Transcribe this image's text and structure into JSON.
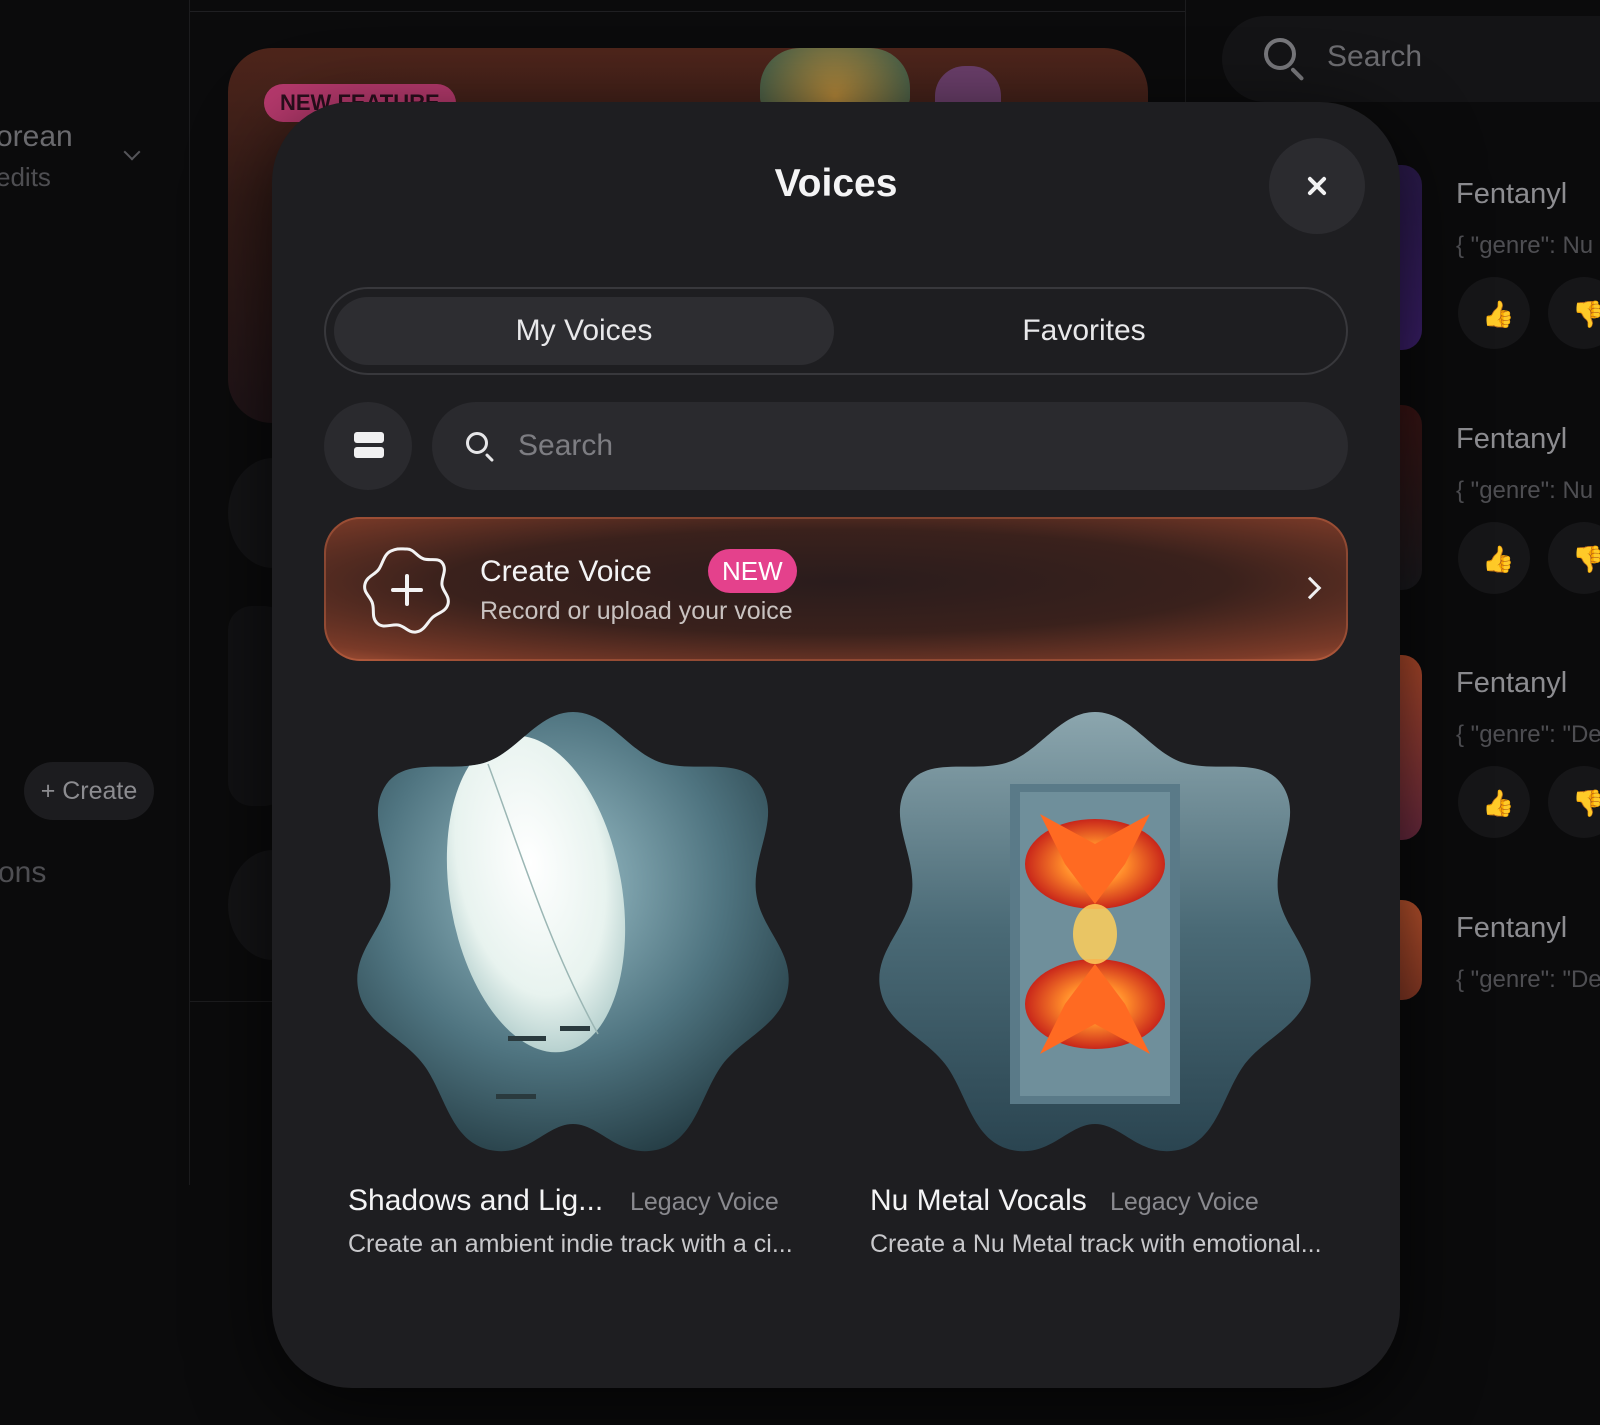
{
  "background": {
    "sidebar": {
      "account_name": "orean",
      "account_sub": "edits",
      "create_label": "+ Create",
      "section_label": "ons"
    },
    "feature_badge": "NEW FEATURE",
    "search_placeholder": "Search",
    "feed": [
      {
        "title": "Fentanyl",
        "subtitle": "{ \"genre\": Nu"
      },
      {
        "title": "Fentanyl",
        "subtitle": "{ \"genre\": Nu"
      },
      {
        "title": "Fentanyl",
        "subtitle": "{ \"genre\": \"De"
      },
      {
        "title": "Fentanyl",
        "subtitle": "{ \"genre\": \"De"
      }
    ]
  },
  "modal": {
    "title": "Voices",
    "tabs": [
      {
        "label": "My Voices",
        "active": true
      },
      {
        "label": "Favorites",
        "active": false
      }
    ],
    "search_placeholder": "Search",
    "create_card": {
      "title": "Create Voice",
      "badge": "NEW",
      "subtitle": "Record or upload your voice"
    },
    "voices": [
      {
        "name": "Shadows and Lig...",
        "tag": "Legacy Voice",
        "description": "Create an ambient indie track with a ci...",
        "art": "moon-portal"
      },
      {
        "name": "Nu Metal Vocals",
        "tag": "Legacy Voice",
        "description": "Create a Nu Metal track with emotional...",
        "art": "phoenix"
      }
    ]
  },
  "colors": {
    "modal_bg": "#1e1e21",
    "badge_pink": "#e4418c",
    "create_glow": "#c0603e"
  }
}
